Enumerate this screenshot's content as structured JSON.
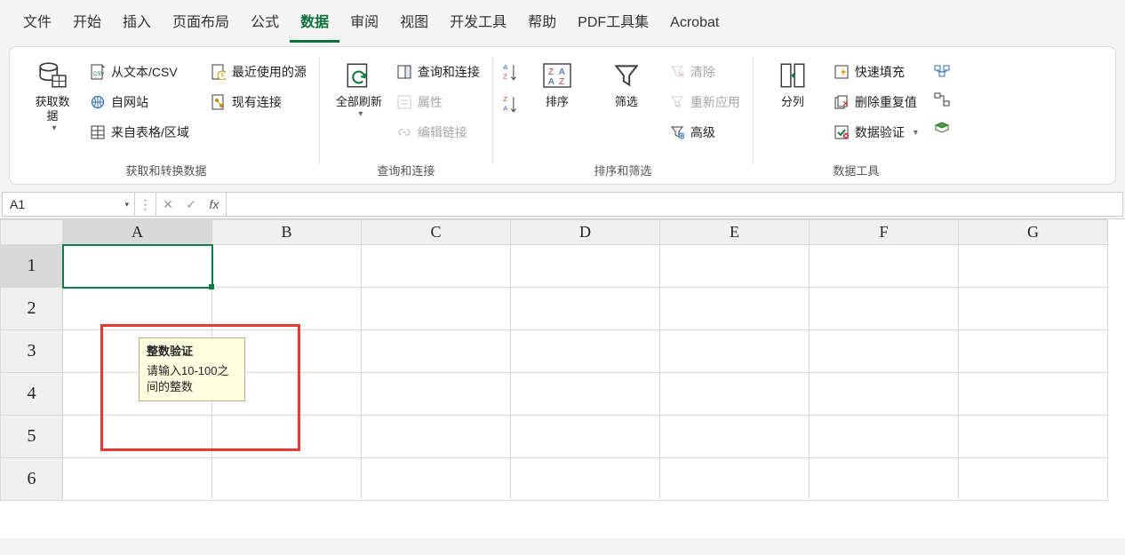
{
  "tabs": {
    "file": "文件",
    "home": "开始",
    "insert": "插入",
    "layout": "页面布局",
    "formula": "公式",
    "data": "数据",
    "review": "审阅",
    "view": "视图",
    "dev": "开发工具",
    "help": "帮助",
    "pdf": "PDF工具集",
    "acrobat": "Acrobat"
  },
  "ribbon": {
    "getdata_btn": "获取数\n据",
    "from_csv": "从文本/CSV",
    "from_web": "自网站",
    "from_table": "来自表格/区域",
    "recent_src": "最近使用的源",
    "existing_conn": "现有连接",
    "group_get": "获取和转换数据",
    "refresh_all": "全部刷新",
    "queries": "查询和连接",
    "properties": "属性",
    "edit_links": "编辑链接",
    "group_conn": "查询和连接",
    "sort": "排序",
    "filter": "筛选",
    "clear": "清除",
    "reapply": "重新应用",
    "advanced": "高级",
    "group_sort": "排序和筛选",
    "text_to_col": "分列",
    "flash_fill": "快速填充",
    "remove_dup": "删除重复值",
    "data_valid": "数据验证",
    "group_tools": "数据工具"
  },
  "formula_bar": {
    "cell_ref": "A1"
  },
  "columns": [
    "A",
    "B",
    "C",
    "D",
    "E",
    "F",
    "G"
  ],
  "rows": [
    "1",
    "2",
    "3",
    "4",
    "5",
    "6"
  ],
  "validation": {
    "title": "整数验证",
    "msg": "请输入10-100之间的整数"
  }
}
